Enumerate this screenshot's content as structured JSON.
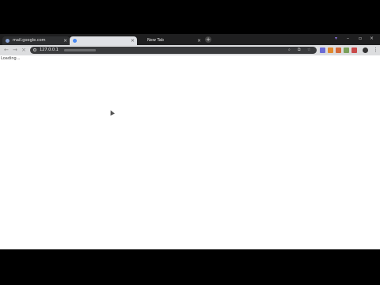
{
  "tabs": [
    {
      "title": "mail.google.com",
      "state": "inactive",
      "favicon_color": "#8aa4d8"
    },
    {
      "title": "",
      "state": "active",
      "favicon_color": "#4a8af4"
    },
    {
      "title": "New Tab",
      "state": "inactive",
      "favicon_color": ""
    }
  ],
  "toolbar": {
    "url": "127.0.0.1"
  },
  "content": {
    "loading_text": "Loading..."
  },
  "icons": {
    "back": "back-arrow-icon",
    "forward": "forward-arrow-icon",
    "reload": "reload-icon",
    "new_tab": "plus-icon",
    "menu": "three-dot-menu-icon"
  },
  "colors": {
    "tabstrip": "#1f1f20",
    "toolbar": "#dcdddf",
    "omnibox": "#3a3b3d",
    "page": "#ffffff"
  }
}
